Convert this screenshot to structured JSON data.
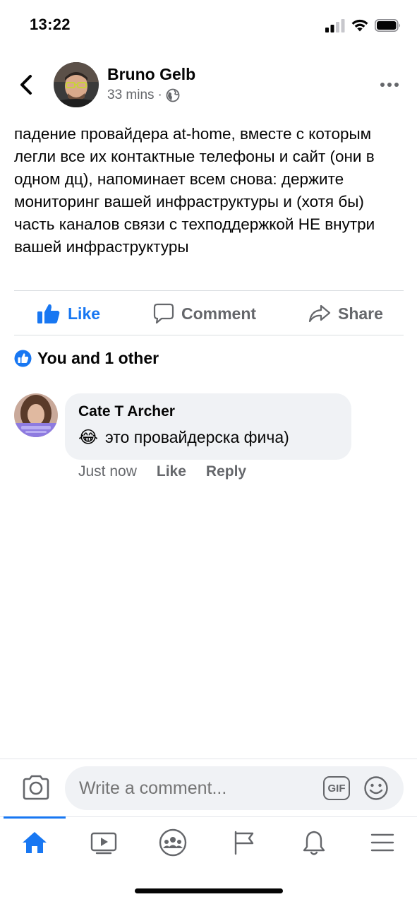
{
  "status_bar": {
    "time": "13:22",
    "icons": [
      "cellular-signal-icon",
      "wifi-icon",
      "battery-icon"
    ]
  },
  "post": {
    "author": "Bruno Gelb",
    "time": "33 mins",
    "separator": "·",
    "privacy_icon": "globe-icon",
    "text": "падение провайдера at-home, вместе с которым легли все их контактные телефоны и сайт (они в одном дц), напоминает всем снова: держите мониторинг вашей инфраструктуры и (хотя бы) часть каналов связи с техподдержкой НЕ внутри вашей инфраструктуры"
  },
  "actions": {
    "like": "Like",
    "comment": "Comment",
    "share": "Share"
  },
  "reactions": {
    "text": "You and 1 other",
    "icon": "like-reaction-icon"
  },
  "comment": {
    "author": "Cate T Archer",
    "emoji": "😂",
    "text": "это провайдерска фича)",
    "time": "Just now",
    "like": "Like",
    "reply": "Reply"
  },
  "composer": {
    "placeholder": "Write a comment...",
    "gif_label": "GIF"
  },
  "tabbar": {
    "items": [
      "home-icon",
      "video-icon",
      "groups-icon",
      "pages-flag-icon",
      "notifications-bell-icon",
      "menu-icon"
    ],
    "active": "home-icon"
  },
  "colors": {
    "accent": "#1877f2",
    "secondary_text": "#65676b",
    "bubble_bg": "#f0f2f5",
    "divider": "#dadde1"
  }
}
